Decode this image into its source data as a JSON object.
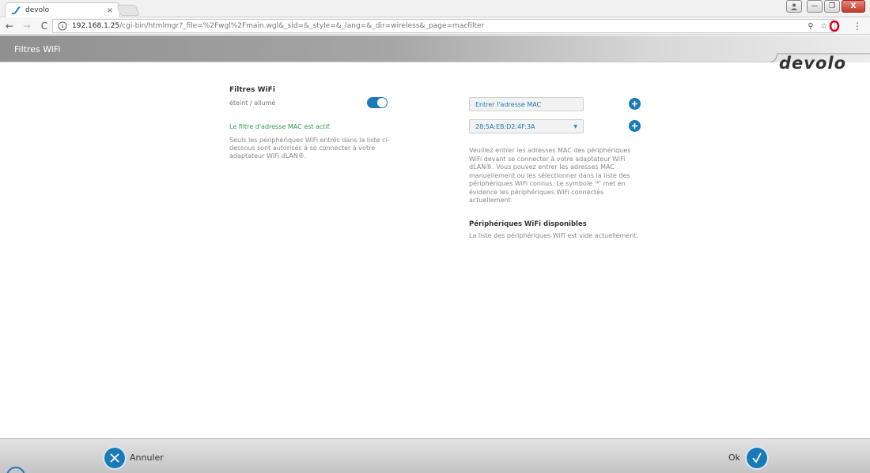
{
  "browser": {
    "tab_title": "devolo",
    "tab_close": "×",
    "url_host": "192.168.1.25",
    "url_path": "/cgi-bin/htmlmgr?_file=%2Fwgl%2Fmain.wgl&_sid=&_style=&_lang=&_dir=wireless&_page=macfilter",
    "back": "←",
    "forward": "→",
    "reload": "C",
    "zoom_icon": "⚲",
    "star_icon": "☆",
    "menu_icon": "⋮",
    "win_minimize": "—",
    "win_restore": "❐",
    "win_close": "X"
  },
  "header": {
    "title": "Filtres WiFi",
    "logo": "devolo"
  },
  "left": {
    "section_title": "Filtres WiFi",
    "toggle_label": "éteint / allumé",
    "toggle_on": true,
    "status": "Le filtre d'adresse MAC est actif.",
    "description": "Seuls les périphériques WiFi entrés dans la liste ci-dessous sont autorisés à se connecter à votre adaptateur WiFi dLAN®."
  },
  "right": {
    "mac_placeholder": "Entrer l'adresse MAC",
    "selected_mac": "28:5A:EB:D2:4F:3A",
    "description": "Veuillez entrer les adresses MAC des périphériques WiFi devant se connecter à votre adaptateur WiFi dLAN®. Vous pouvez entrer les adresses MAC manuellement ou les sélectionner dans la liste des périphériques WiFi connus. Le symbole '*' met en évidence les périphériques WiFi connectés actuellement.",
    "available_title": "Périphériques WiFi disponibles",
    "available_empty": "La liste des périphériques WiFi est vide actuellement."
  },
  "footer": {
    "cancel_label": "Annuler",
    "ok_label": "Ok"
  },
  "colors": {
    "accent": "#1a7ab8",
    "status_green": "#2f9a4a"
  }
}
